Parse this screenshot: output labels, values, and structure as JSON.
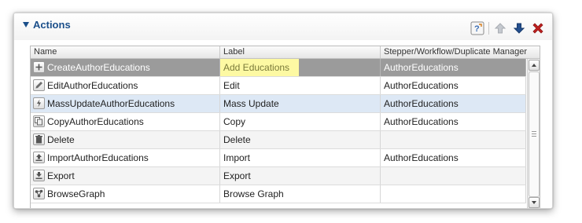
{
  "panel": {
    "title": "Actions",
    "toolbar": {
      "help_icon": "help-icon",
      "up_icon": "arrow-up-icon",
      "down_icon": "arrow-down-icon",
      "delete_icon": "delete-x-icon"
    }
  },
  "grid": {
    "columns": [
      "Name",
      "Label",
      "Stepper/Workflow/Duplicate Manager"
    ],
    "rows": [
      {
        "icon": "plus-icon",
        "name": "CreateAuthorEducations",
        "label": "Add Educations",
        "manager": "AuthorEducations",
        "state": "selected"
      },
      {
        "icon": "pencil-icon",
        "name": "EditAuthorEducations",
        "label": "Edit",
        "manager": "AuthorEducations",
        "state": "normal"
      },
      {
        "icon": "lightning-icon",
        "name": "MassUpdateAuthorEducations",
        "label": "Mass Update",
        "manager": "AuthorEducations",
        "state": "hover"
      },
      {
        "icon": "copy-icon",
        "name": "CopyAuthorEducations",
        "label": "Copy",
        "manager": "AuthorEducations",
        "state": "normal"
      },
      {
        "icon": "trash-icon",
        "name": "Delete",
        "label": "Delete",
        "manager": "",
        "state": "alt"
      },
      {
        "icon": "import-icon",
        "name": "ImportAuthorEducations",
        "label": "Import",
        "manager": "AuthorEducations",
        "state": "normal"
      },
      {
        "icon": "export-icon",
        "name": "Export",
        "label": "Export",
        "manager": "",
        "state": "alt"
      },
      {
        "icon": "graph-icon",
        "name": "BrowseGraph",
        "label": "Browse Graph",
        "manager": "",
        "state": "normal"
      }
    ]
  },
  "colors": {
    "title": "#1b4f8a",
    "selected_row": "#9b9b9b",
    "hover_row": "#dde8f5",
    "label_highlight": "#fdf9a3",
    "delete": "#c0201f"
  }
}
